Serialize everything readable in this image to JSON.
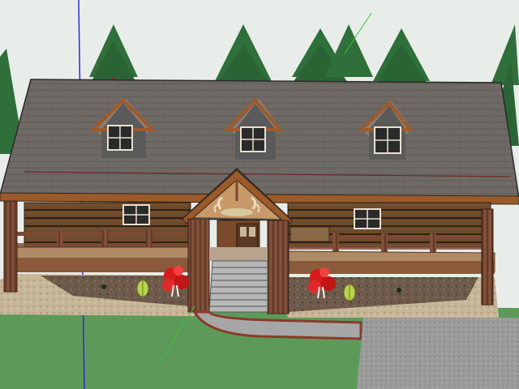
{
  "viewport": {
    "sky_color": "#e9edea",
    "ground_color": "#5d9a5a",
    "axis_colors": {
      "blue_axis": "#2b2bd6",
      "green_axis": "#3fbf3f"
    }
  },
  "model": {
    "roof_color": "#6f6a66",
    "log_wall_color": "#6d4a2a",
    "trim_color": "#9a5a2a",
    "porch_floor_color": "#b08a66",
    "walkway_color": "#a7a7a7",
    "flower_color": "#d81a1a",
    "shrub_color": "#b9d24a",
    "icons": [
      "pine-tree-icon",
      "dormer-window-icon",
      "antler-chandelier-icon",
      "flower-bush-icon",
      "shrub-icon"
    ]
  }
}
